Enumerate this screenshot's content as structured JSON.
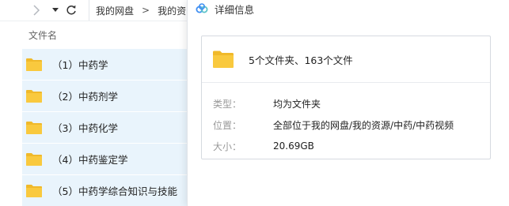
{
  "toolbar": {
    "breadcrumb": [
      "我的网盘",
      "我的资"
    ],
    "breadcrumb_separator": ">"
  },
  "file_list": {
    "column_header": "文件名",
    "items": [
      {
        "name": "（1）中药学",
        "icon": "folder-icon"
      },
      {
        "name": "（2）中药剂学",
        "icon": "folder-icon"
      },
      {
        "name": "（3）中药化学",
        "icon": "folder-icon"
      },
      {
        "name": "（4）中药鉴定学",
        "icon": "folder-icon"
      },
      {
        "name": "（5）中药学综合知识与技能",
        "icon": "folder-icon"
      }
    ]
  },
  "details": {
    "title": "详细信息",
    "summary": "5个文件夹、163个文件",
    "rows": [
      {
        "label": "类型：",
        "value": "均为文件夹"
      },
      {
        "label": "位置：",
        "value": "全部位于我的网盘/我的资源/中药/中药视频"
      },
      {
        "label": "大小：",
        "value": "20.69GB"
      }
    ]
  },
  "colors": {
    "selected_row": "#e9f4fc",
    "folder_yellow": "#f9c93e",
    "folder_yellow_dark": "#f0b92a",
    "logo_blue": "#3f8ef2",
    "logo_teal": "#5cc3c9"
  }
}
